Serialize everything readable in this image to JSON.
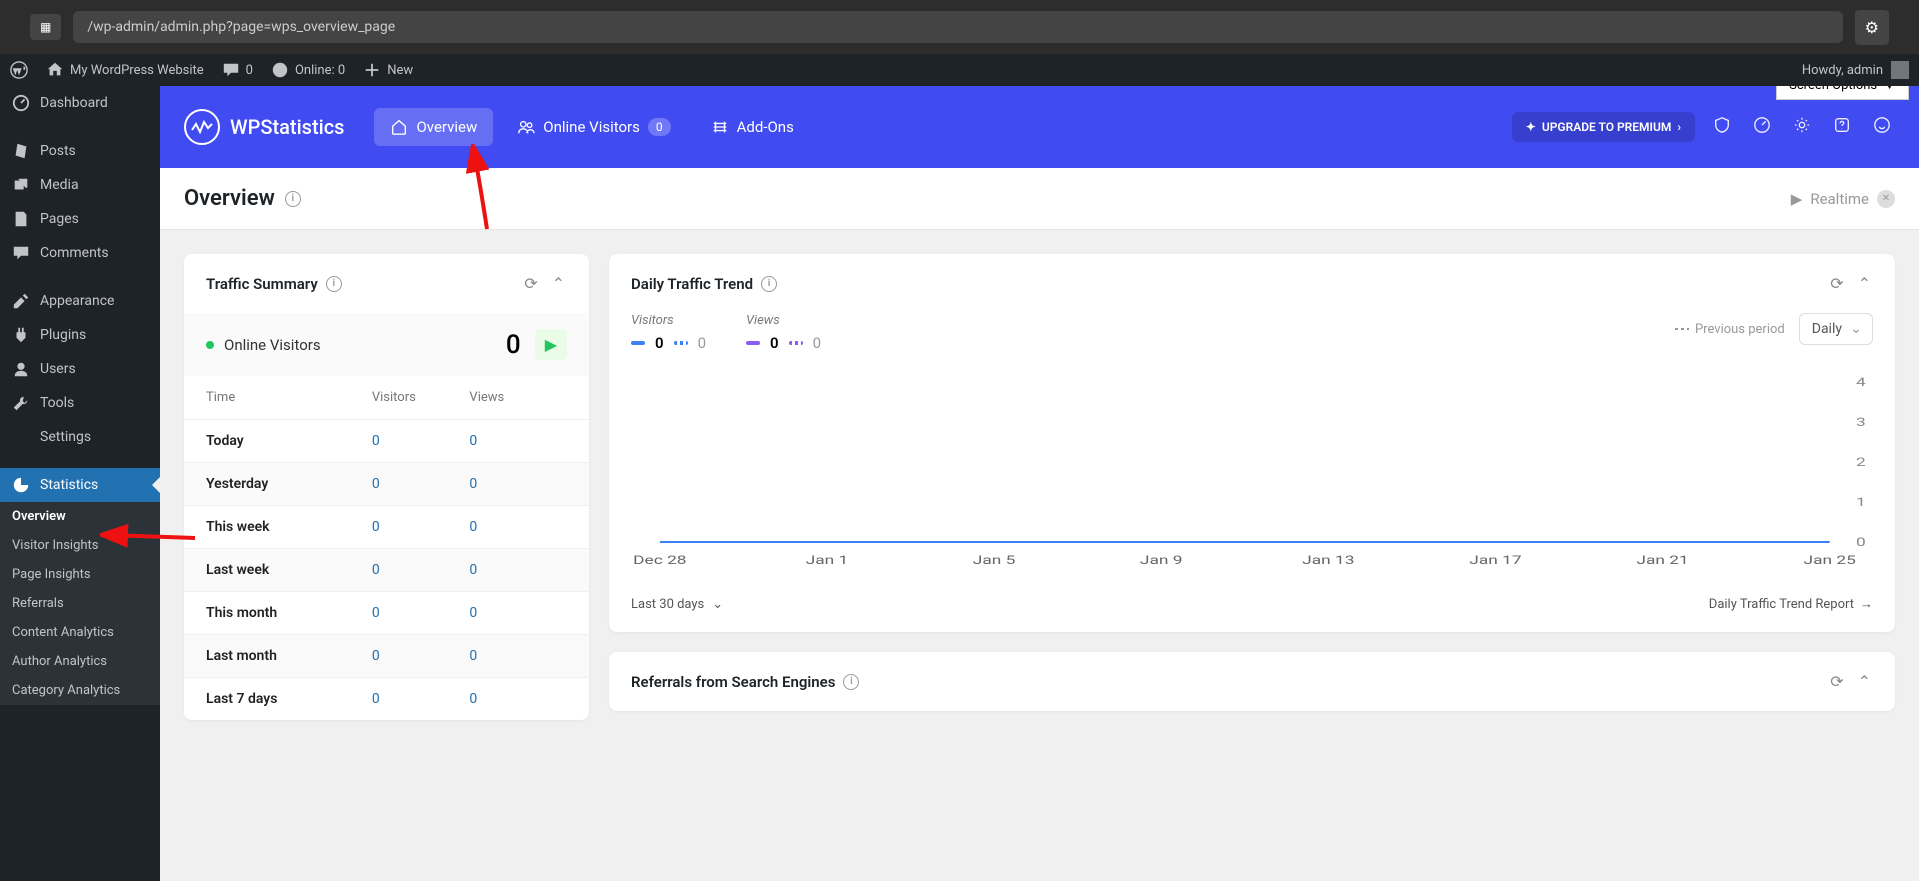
{
  "browser": {
    "url": "/wp-admin/admin.php?page=wps_overview_page"
  },
  "adminbar": {
    "site_name": "My WordPress Website",
    "comments": "0",
    "online_label": "Online: 0",
    "new_label": "New",
    "howdy": "Howdy, admin"
  },
  "sidebar": {
    "items": [
      "Dashboard",
      "Posts",
      "Media",
      "Pages",
      "Comments",
      "Appearance",
      "Plugins",
      "Users",
      "Tools",
      "Settings",
      "Statistics"
    ],
    "subitems": [
      "Overview",
      "Visitor Insights",
      "Page Insights",
      "Referrals",
      "Content Analytics",
      "Author Analytics",
      "Category Analytics"
    ]
  },
  "wps_header": {
    "brand": "WPStatistics",
    "nav": {
      "overview": "Overview",
      "online": "Online Visitors",
      "online_badge": "0",
      "addons": "Add-Ons"
    },
    "upgrade": "UPGRADE TO PREMIUM",
    "screen_options": "Screen Options"
  },
  "page": {
    "title": "Overview",
    "realtime": "Realtime"
  },
  "traffic_summary": {
    "title": "Traffic Summary",
    "online_label": "Online Visitors",
    "online_count": "0",
    "headers": {
      "time": "Time",
      "visitors": "Visitors",
      "views": "Views"
    },
    "rows": [
      {
        "time": "Today",
        "visitors": "0",
        "views": "0"
      },
      {
        "time": "Yesterday",
        "visitors": "0",
        "views": "0"
      },
      {
        "time": "This week",
        "visitors": "0",
        "views": "0"
      },
      {
        "time": "Last week",
        "visitors": "0",
        "views": "0"
      },
      {
        "time": "This month",
        "visitors": "0",
        "views": "0"
      },
      {
        "time": "Last month",
        "visitors": "0",
        "views": "0"
      },
      {
        "time": "Last 7 days",
        "visitors": "0",
        "views": "0"
      }
    ]
  },
  "daily_trend": {
    "title": "Daily Traffic Trend",
    "legend": {
      "visitors": "Visitors",
      "views": "Views",
      "v1": "0",
      "v1b": "0",
      "v2": "0",
      "v2b": "0"
    },
    "prev_period": "Previous period",
    "period_select": "Daily",
    "range": "Last 30 days",
    "report_link": "Daily Traffic Trend Report"
  },
  "referrals": {
    "title": "Referrals from Search Engines"
  },
  "chart_data": {
    "type": "line",
    "title": "Daily Traffic Trend",
    "xlabel": "",
    "ylabel": "",
    "ylim": [
      0,
      4
    ],
    "yticks": [
      0,
      1,
      2,
      3,
      4
    ],
    "categories": [
      "Dec 28",
      "Jan 1",
      "Jan 5",
      "Jan 9",
      "Jan 13",
      "Jan 17",
      "Jan 21",
      "Jan 25"
    ],
    "series": [
      {
        "name": "Visitors",
        "values": [
          0,
          0,
          0,
          0,
          0,
          0,
          0,
          0
        ]
      },
      {
        "name": "Views",
        "values": [
          0,
          0,
          0,
          0,
          0,
          0,
          0,
          0
        ]
      }
    ]
  }
}
